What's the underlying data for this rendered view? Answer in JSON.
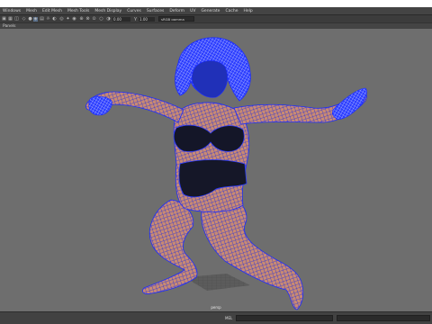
{
  "menubar": {
    "items": [
      "Windows",
      "Mesh",
      "Edit Mesh",
      "Mesh Tools",
      "Mesh Display",
      "Curves",
      "Surfaces",
      "Deform",
      "UV",
      "Generate",
      "Cache",
      "Help"
    ]
  },
  "toolbar": {
    "exposure_value": "0.00",
    "gamma_value": "1.00",
    "color_space_value": "sRGB gamma"
  },
  "panels": {
    "label": "Panels"
  },
  "viewport": {
    "camera_label": "persp",
    "background_color": "#6e6e6e",
    "wireframe_color": "#1a2cff"
  },
  "statusbar": {
    "command_language": "MEL"
  }
}
